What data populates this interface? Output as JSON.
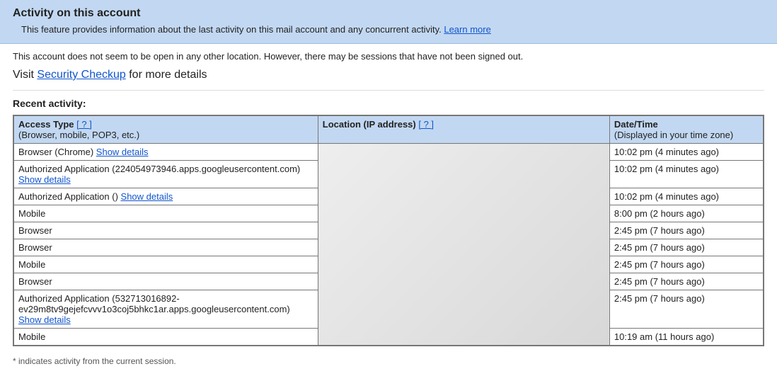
{
  "banner": {
    "title": "Activity on this account",
    "subtitle_prefix": "This feature provides information about the last activity on this mail account and any concurrent activity. ",
    "learn_more": "Learn more"
  },
  "status": "This account does not seem to be open in any other location. However, there may be sessions that have not been signed out.",
  "visit": {
    "prefix": "Visit ",
    "link": "Security Checkup",
    "suffix": " for more details"
  },
  "recent_title": "Recent activity:",
  "columns": {
    "access": {
      "main": "Access Type ",
      "q": "[ ? ]",
      "sub": "(Browser, mobile, POP3, etc.)"
    },
    "location": {
      "main": "Location (IP address) ",
      "q": "[ ? ]"
    },
    "date": {
      "main": "Date/Time",
      "sub": "(Displayed in your time zone)"
    }
  },
  "rows": [
    {
      "access_text": "Browser (Chrome) ",
      "show_details": "Show details",
      "date": "10:02 pm (4 minutes ago)"
    },
    {
      "access_text": "Authorized Application (224054973946.apps.googleusercontent.com)",
      "show_details_newline": "Show details",
      "date": "10:02 pm (4 minutes ago)"
    },
    {
      "access_text": "Authorized Application () ",
      "show_details": "Show details",
      "date": "10:02 pm (4 minutes ago)"
    },
    {
      "access_text": "Mobile",
      "date": "8:00 pm (2 hours ago)"
    },
    {
      "access_text": "Browser",
      "date": "2:45 pm (7 hours ago)"
    },
    {
      "access_text": "Browser",
      "date": "2:45 pm (7 hours ago)"
    },
    {
      "access_text": "Mobile",
      "date": "2:45 pm (7 hours ago)"
    },
    {
      "access_text": "Browser",
      "date": "2:45 pm (7 hours ago)"
    },
    {
      "access_text": "Authorized Application (532713016892-ev29m8tv9gejefcvvv1o3coj5bhkc1ar.apps.googleusercontent.com)",
      "show_details_newline": "Show details",
      "date": "2:45 pm (7 hours ago)"
    },
    {
      "access_text": "Mobile",
      "date": "10:19 am (11 hours ago)"
    }
  ],
  "footnote": "* indicates activity from the current session."
}
